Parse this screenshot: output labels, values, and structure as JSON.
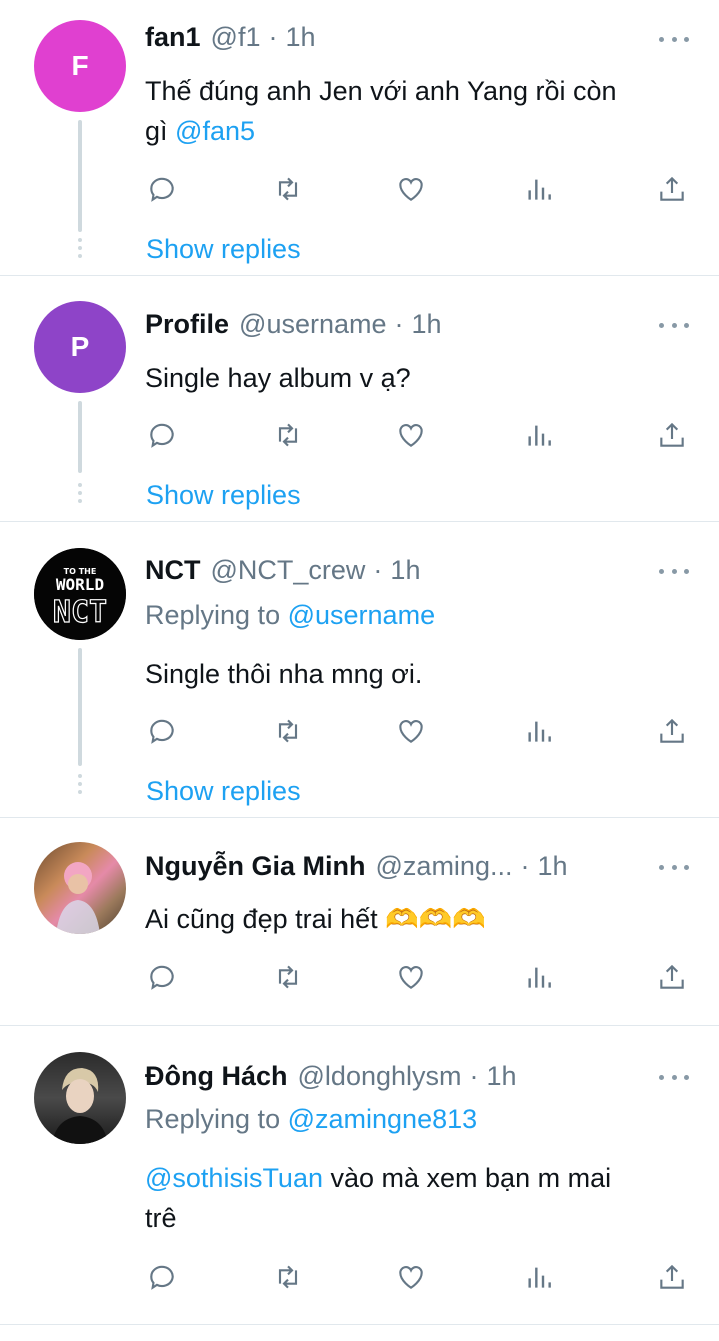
{
  "tweets": [
    {
      "avatar_letter": "F",
      "avatar_color": "#e040d0",
      "name": "fan1",
      "handle": "@f1",
      "time": "1h",
      "text_lines": [
        "Thế đúng anh Jen với anh Yang rồi còn",
        "gì"
      ],
      "mention": "@fan5",
      "show_replies": "Show replies"
    },
    {
      "avatar_letter": "P",
      "avatar_color": "#8e44c8",
      "name": "Profile",
      "handle": "@username",
      "time": "1h",
      "text": "Single hay album v ạ?",
      "show_replies": "Show replies"
    },
    {
      "avatar_label": "TO THE WORLD NCT",
      "name": "NCT",
      "handle": "@NCT_crew",
      "time": "1h",
      "replying_prefix": "Replying to",
      "replying_to": "@username",
      "text": "Single thôi nha mng ơi.",
      "show_replies": "Show replies"
    },
    {
      "name": "Nguyễn Gia Minh",
      "handle": "@zaming...",
      "time": "1h",
      "text": "Ai cũng đẹp trai hết 🫶🫶🫶"
    },
    {
      "name": "Đông Hách",
      "handle": "@ldonghlysm",
      "time": "1h",
      "replying_prefix": "Replying to",
      "replying_to": "@zamingne813",
      "mention": "@sothisisTuan",
      "text_rest": " vào mà xem bạn m mai",
      "text_line2": "trê"
    }
  ],
  "separator": "·",
  "icons": [
    "reply-icon",
    "retweet-icon",
    "like-icon",
    "analytics-icon",
    "share-icon"
  ],
  "colors": {
    "link": "#1da1f2",
    "muted": "#657786",
    "divider": "#e1e8ed"
  }
}
